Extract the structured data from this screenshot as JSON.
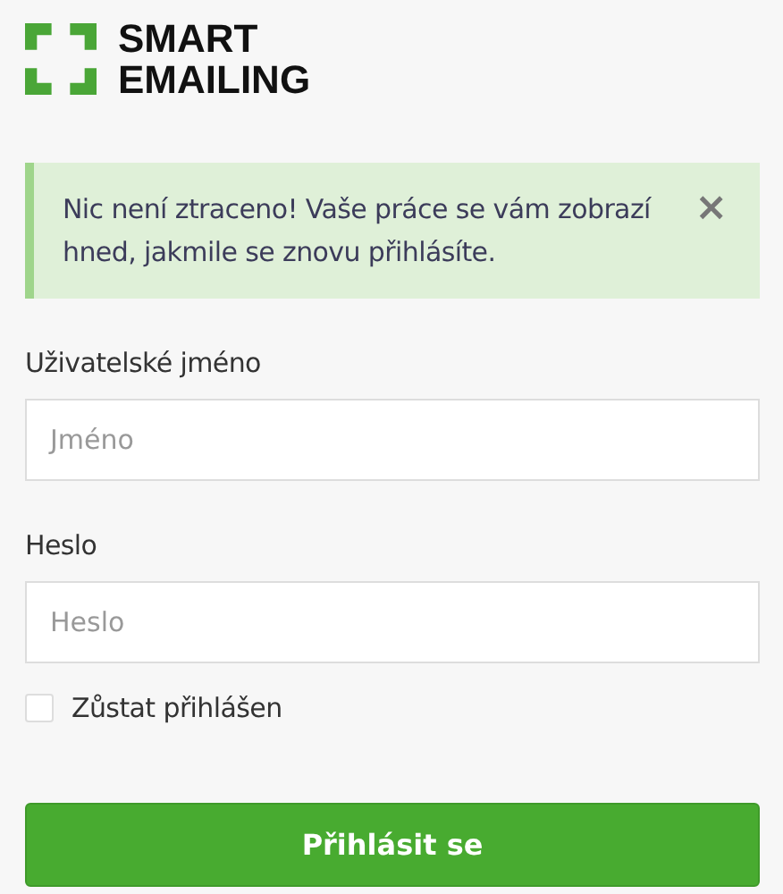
{
  "logo": {
    "lines": [
      "SMART",
      "EMAILING"
    ]
  },
  "alert": {
    "message": "Nic není ztraceno! Vaše práce se vám zobrazí hned, jakmile se znovu přihlásíte.",
    "close": "×"
  },
  "fields": [
    {
      "label": "Uživatelské jméno",
      "placeholder": "Jméno"
    },
    {
      "label": "Heslo",
      "placeholder": "Heslo"
    }
  ],
  "remember": {
    "label": "Zůstat přihlášen",
    "checked": false
  },
  "submit": "Přihlásit se"
}
